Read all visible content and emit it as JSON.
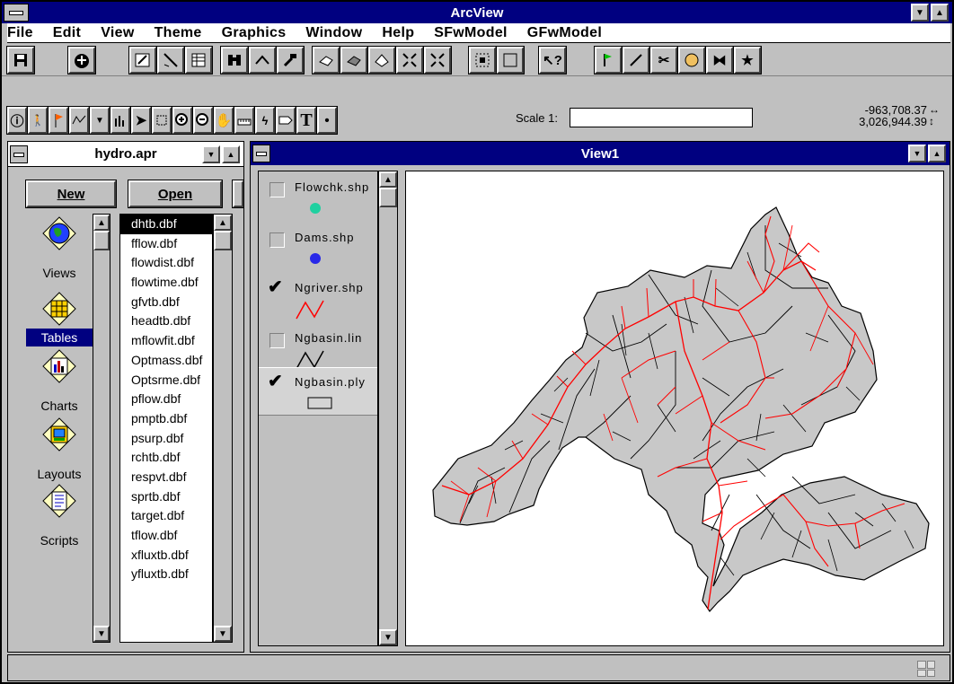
{
  "app": {
    "title": "ArcView"
  },
  "menu": {
    "file": "File",
    "edit": "Edit",
    "view": "View",
    "theme": "Theme",
    "graphics": "Graphics",
    "window": "Window",
    "help": "Help",
    "sfwmodel": "SFwModel",
    "gfwmodel": "GFwModel"
  },
  "toolbar": {
    "scale_label": "Scale 1:",
    "scale_value": "",
    "coord_x": "-963,708.37",
    "coord_y": "3,026,944.39"
  },
  "project_window": {
    "title": "hydro.apr",
    "new_label": "New",
    "open_label": "Open",
    "doc_types": [
      {
        "label": "Views",
        "icon": "globe-icon"
      },
      {
        "label": "Tables",
        "icon": "table-icon"
      },
      {
        "label": "Charts",
        "icon": "chart-icon"
      },
      {
        "label": "Layouts",
        "icon": "layout-icon"
      },
      {
        "label": "Scripts",
        "icon": "script-icon"
      }
    ],
    "selected_doc_type": "Tables",
    "files": [
      "dhtb.dbf",
      "fflow.dbf",
      "flowdist.dbf",
      "flowtime.dbf",
      "gfvtb.dbf",
      "headtb.dbf",
      "mflowfit.dbf",
      "Optmass.dbf",
      "Optsrme.dbf",
      "pflow.dbf",
      "pmptb.dbf",
      "psurp.dbf",
      "rchtb.dbf",
      "respvt.dbf",
      "sprtb.dbf",
      "target.dbf",
      "tflow.dbf",
      "xfluxtb.dbf",
      "yfluxtb.dbf"
    ],
    "selected_file": "dhtb.dbf"
  },
  "view_window": {
    "title": "View1",
    "themes": [
      {
        "name": "Flowchk.shp",
        "checked": false,
        "symbol": "point",
        "color": "#20c8a0"
      },
      {
        "name": "Dams.shp",
        "checked": false,
        "symbol": "point",
        "color": "#2020e0"
      },
      {
        "name": "Ngriver.shp",
        "checked": true,
        "symbol": "line",
        "color": "#ff0000"
      },
      {
        "name": "Ngbasin.lin",
        "checked": false,
        "symbol": "line",
        "color": "#000000"
      },
      {
        "name": "Ngbasin.ply",
        "checked": true,
        "symbol": "polygon",
        "color": "#d4d4d4"
      }
    ]
  },
  "colors": {
    "title_active": "#000080",
    "basin_fill": "#c8c8c8",
    "river": "#ff0000"
  }
}
